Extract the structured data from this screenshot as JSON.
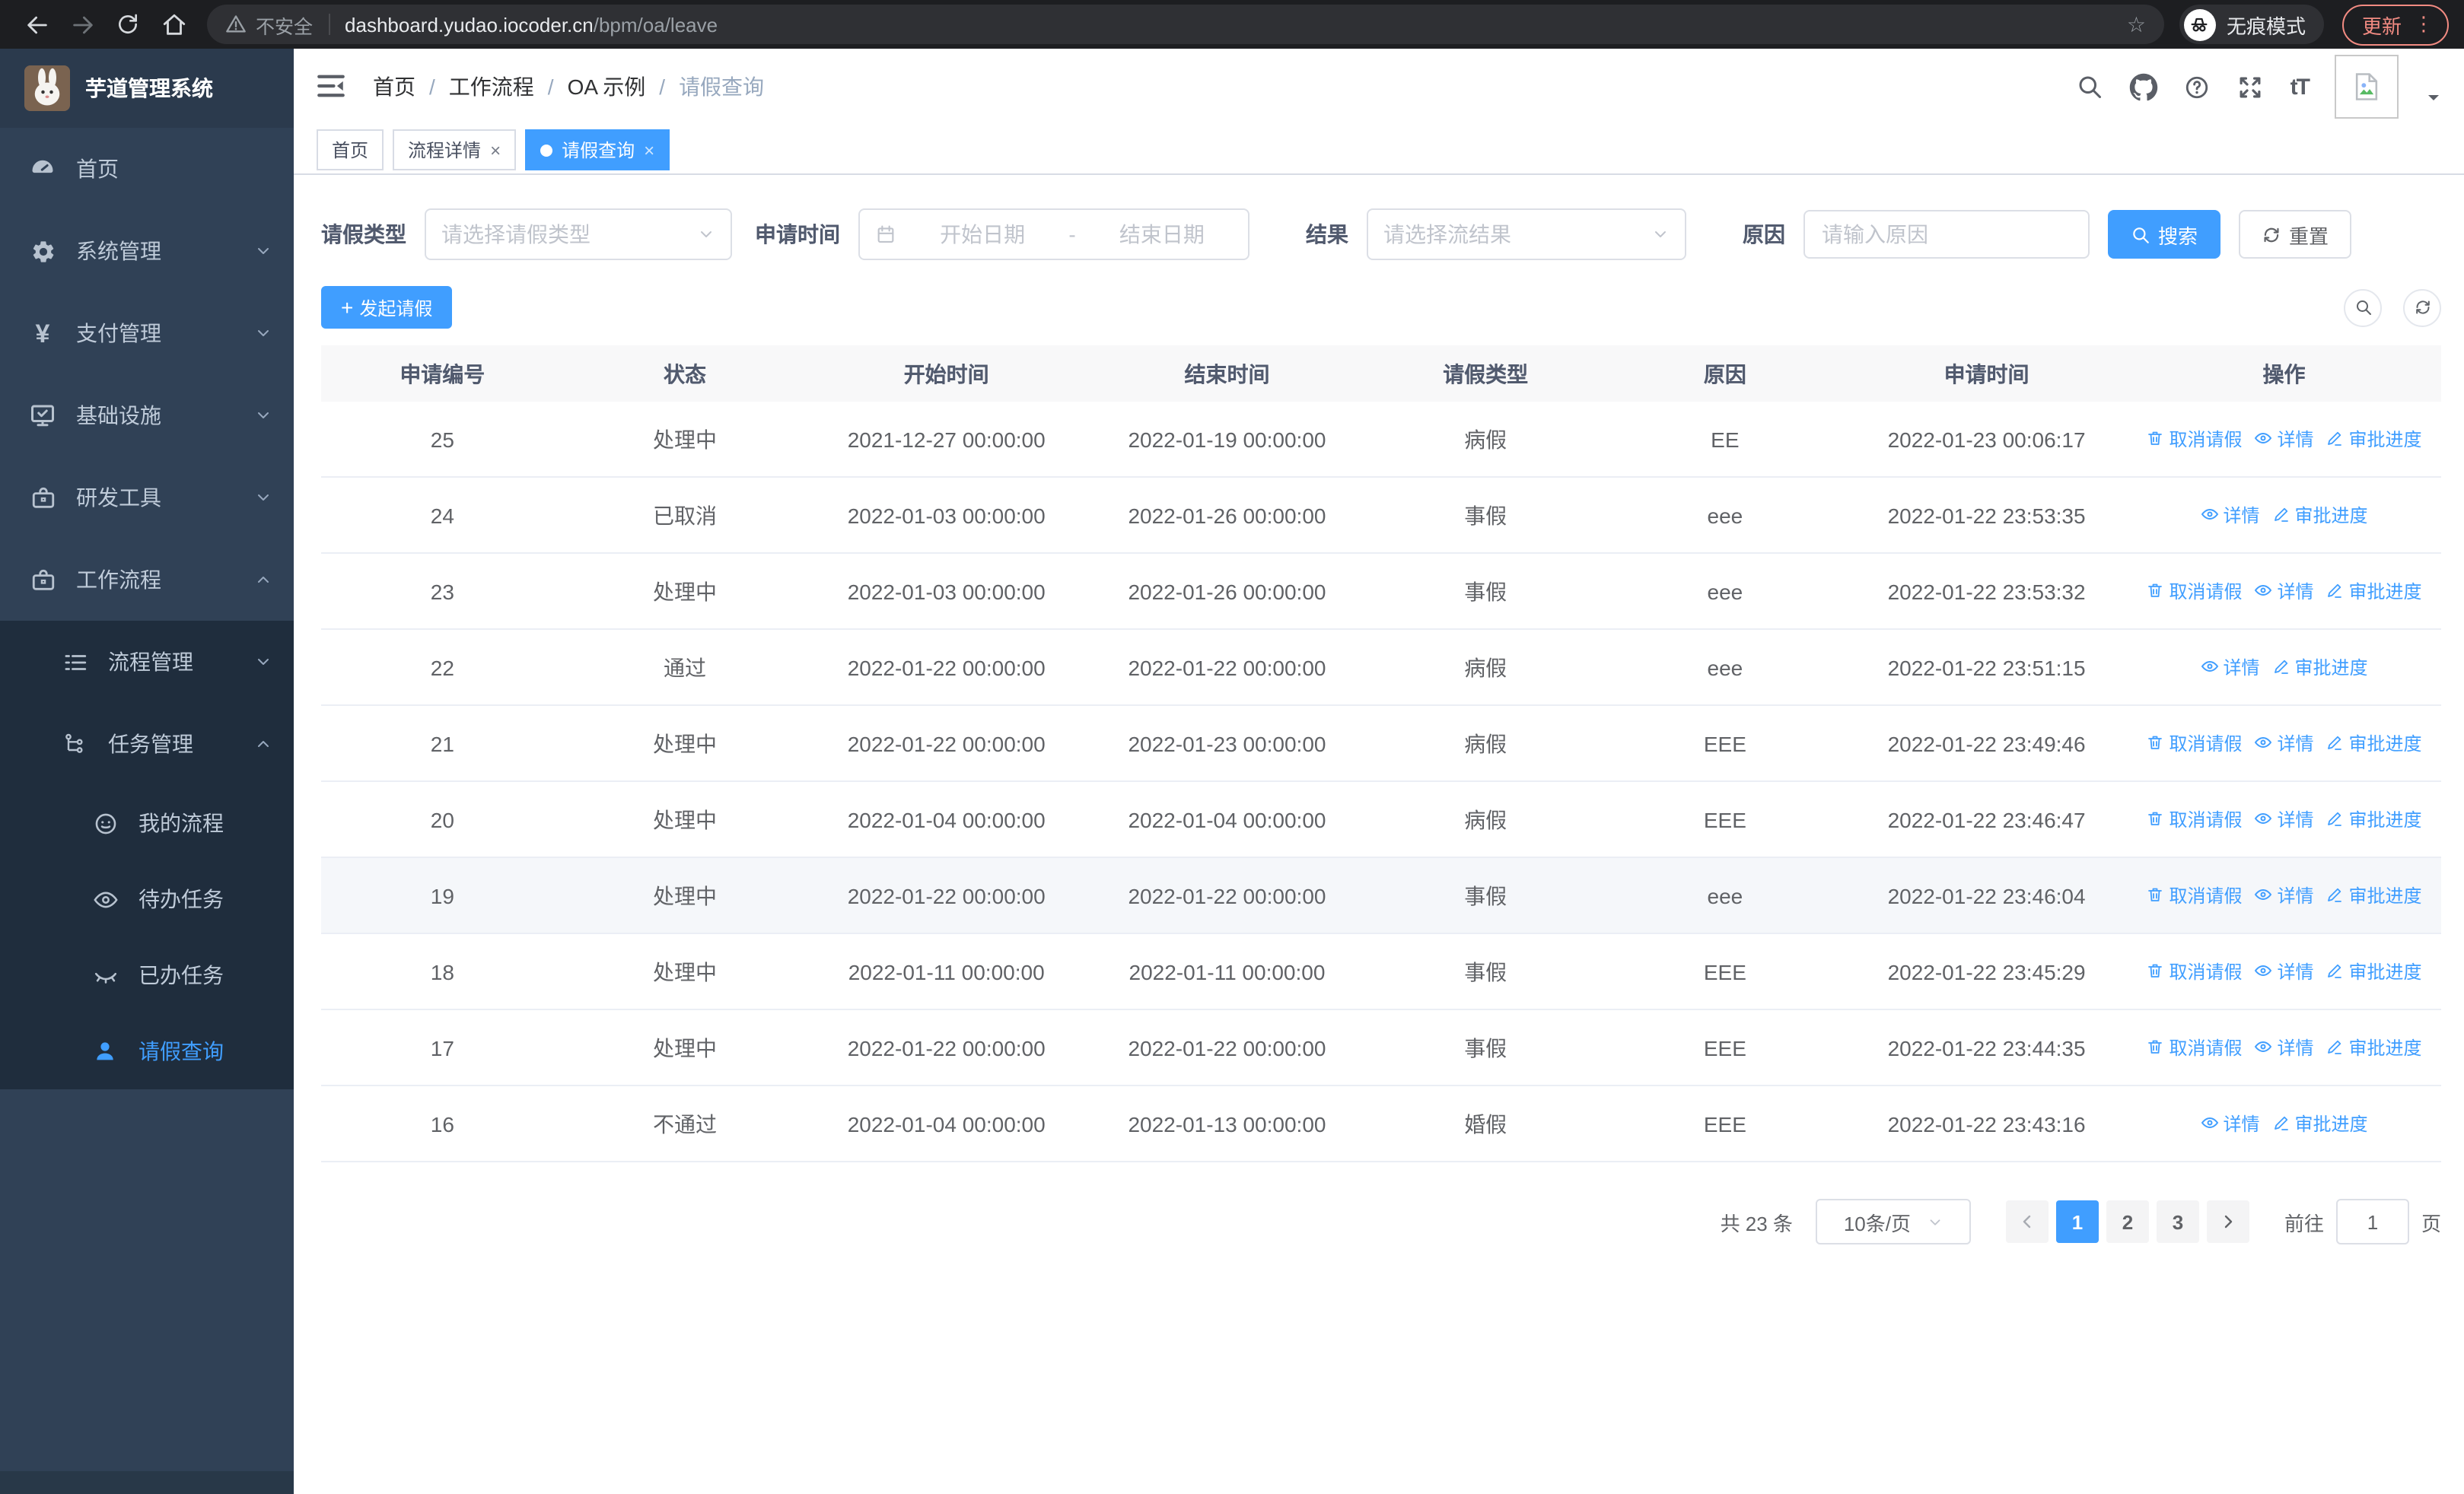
{
  "colors": {
    "primary": "#409eff",
    "sidebar_bg": "#304156",
    "sidebar_submenu_bg": "#1f2d3d",
    "sidebar_text": "#bfcbd9",
    "chrome_bg": "#1d1e21",
    "update_accent": "#f28b82",
    "row_highlight": "#f5f7fa"
  },
  "browser": {
    "security_label": "不安全",
    "url_host": "dashboard.yudao.iocoder.cn",
    "url_path": "/bpm/oa/leave",
    "incognito_label": "无痕模式",
    "update_label": "更新"
  },
  "sidebar": {
    "app_title": "芋道管理系统",
    "items": [
      {
        "label": "首页"
      },
      {
        "label": "系统管理"
      },
      {
        "label": "支付管理"
      },
      {
        "label": "基础设施"
      },
      {
        "label": "研发工具"
      },
      {
        "label": "工作流程"
      }
    ],
    "sub": {
      "process": "流程管理",
      "task": "任务管理",
      "my_process": "我的流程",
      "todo": "待办任务",
      "done": "已办任务",
      "leave": "请假查询"
    }
  },
  "breadcrumb": [
    "首页",
    "工作流程",
    "OA 示例",
    "请假查询"
  ],
  "tabs": [
    {
      "label": "首页"
    },
    {
      "label": "流程详情"
    },
    {
      "label": "请假查询"
    }
  ],
  "filters": {
    "leave_type_label": "请假类型",
    "leave_type_placeholder": "请选择请假类型",
    "apply_time_label": "申请时间",
    "date_start_placeholder": "开始日期",
    "date_separator": "-",
    "date_end_placeholder": "结束日期",
    "result_label": "结果",
    "result_placeholder": "请选择流结果",
    "reason_label": "原因",
    "reason_placeholder": "请输入原因",
    "search_label": "搜索",
    "reset_label": "重置"
  },
  "toolbar": {
    "create_label": "发起请假"
  },
  "table": {
    "headers": [
      "申请编号",
      "状态",
      "开始时间",
      "结束时间",
      "请假类型",
      "原因",
      "申请时间",
      "操作"
    ],
    "actions": {
      "cancel": "取消请假",
      "detail": "详情",
      "progress": "审批进度"
    },
    "rows": [
      {
        "id": "25",
        "status": "处理中",
        "start": "2021-12-27 00:00:00",
        "end": "2022-01-19 00:00:00",
        "type": "病假",
        "reason": "EE",
        "applied": "2022-01-23 00:06:17"
      },
      {
        "id": "24",
        "status": "已取消",
        "start": "2022-01-03 00:00:00",
        "end": "2022-01-26 00:00:00",
        "type": "事假",
        "reason": "eee",
        "applied": "2022-01-22 23:53:35"
      },
      {
        "id": "23",
        "status": "处理中",
        "start": "2022-01-03 00:00:00",
        "end": "2022-01-26 00:00:00",
        "type": "事假",
        "reason": "eee",
        "applied": "2022-01-22 23:53:32"
      },
      {
        "id": "22",
        "status": "通过",
        "start": "2022-01-22 00:00:00",
        "end": "2022-01-22 00:00:00",
        "type": "病假",
        "reason": "eee",
        "applied": "2022-01-22 23:51:15"
      },
      {
        "id": "21",
        "status": "处理中",
        "start": "2022-01-22 00:00:00",
        "end": "2022-01-23 00:00:00",
        "type": "病假",
        "reason": "EEE",
        "applied": "2022-01-22 23:49:46"
      },
      {
        "id": "20",
        "status": "处理中",
        "start": "2022-01-04 00:00:00",
        "end": "2022-01-04 00:00:00",
        "type": "病假",
        "reason": "EEE",
        "applied": "2022-01-22 23:46:47"
      },
      {
        "id": "19",
        "status": "处理中",
        "start": "2022-01-22 00:00:00",
        "end": "2022-01-22 00:00:00",
        "type": "事假",
        "reason": "eee",
        "applied": "2022-01-22 23:46:04"
      },
      {
        "id": "18",
        "status": "处理中",
        "start": "2022-01-11 00:00:00",
        "end": "2022-01-11 00:00:00",
        "type": "事假",
        "reason": "EEE",
        "applied": "2022-01-22 23:45:29"
      },
      {
        "id": "17",
        "status": "处理中",
        "start": "2022-01-22 00:00:00",
        "end": "2022-01-22 00:00:00",
        "type": "事假",
        "reason": "EEE",
        "applied": "2022-01-22 23:44:35"
      },
      {
        "id": "16",
        "status": "不通过",
        "start": "2022-01-04 00:00:00",
        "end": "2022-01-13 00:00:00",
        "type": "婚假",
        "reason": "EEE",
        "applied": "2022-01-22 23:43:16"
      }
    ]
  },
  "pagination": {
    "total": "共 23 条",
    "page_size": "10条/页",
    "prev": "‹",
    "next": "›",
    "pages": [
      "1",
      "2",
      "3"
    ],
    "active_page": "1",
    "goto_label": "前往",
    "goto_value": "1",
    "page_unit": "页"
  },
  "icons": {
    "close": "×",
    "plus": "+",
    "yen": "¥",
    "dots": "⋮",
    "font_size": "tT",
    "star": "☆",
    "separator": "/",
    "range_dash": "-"
  }
}
